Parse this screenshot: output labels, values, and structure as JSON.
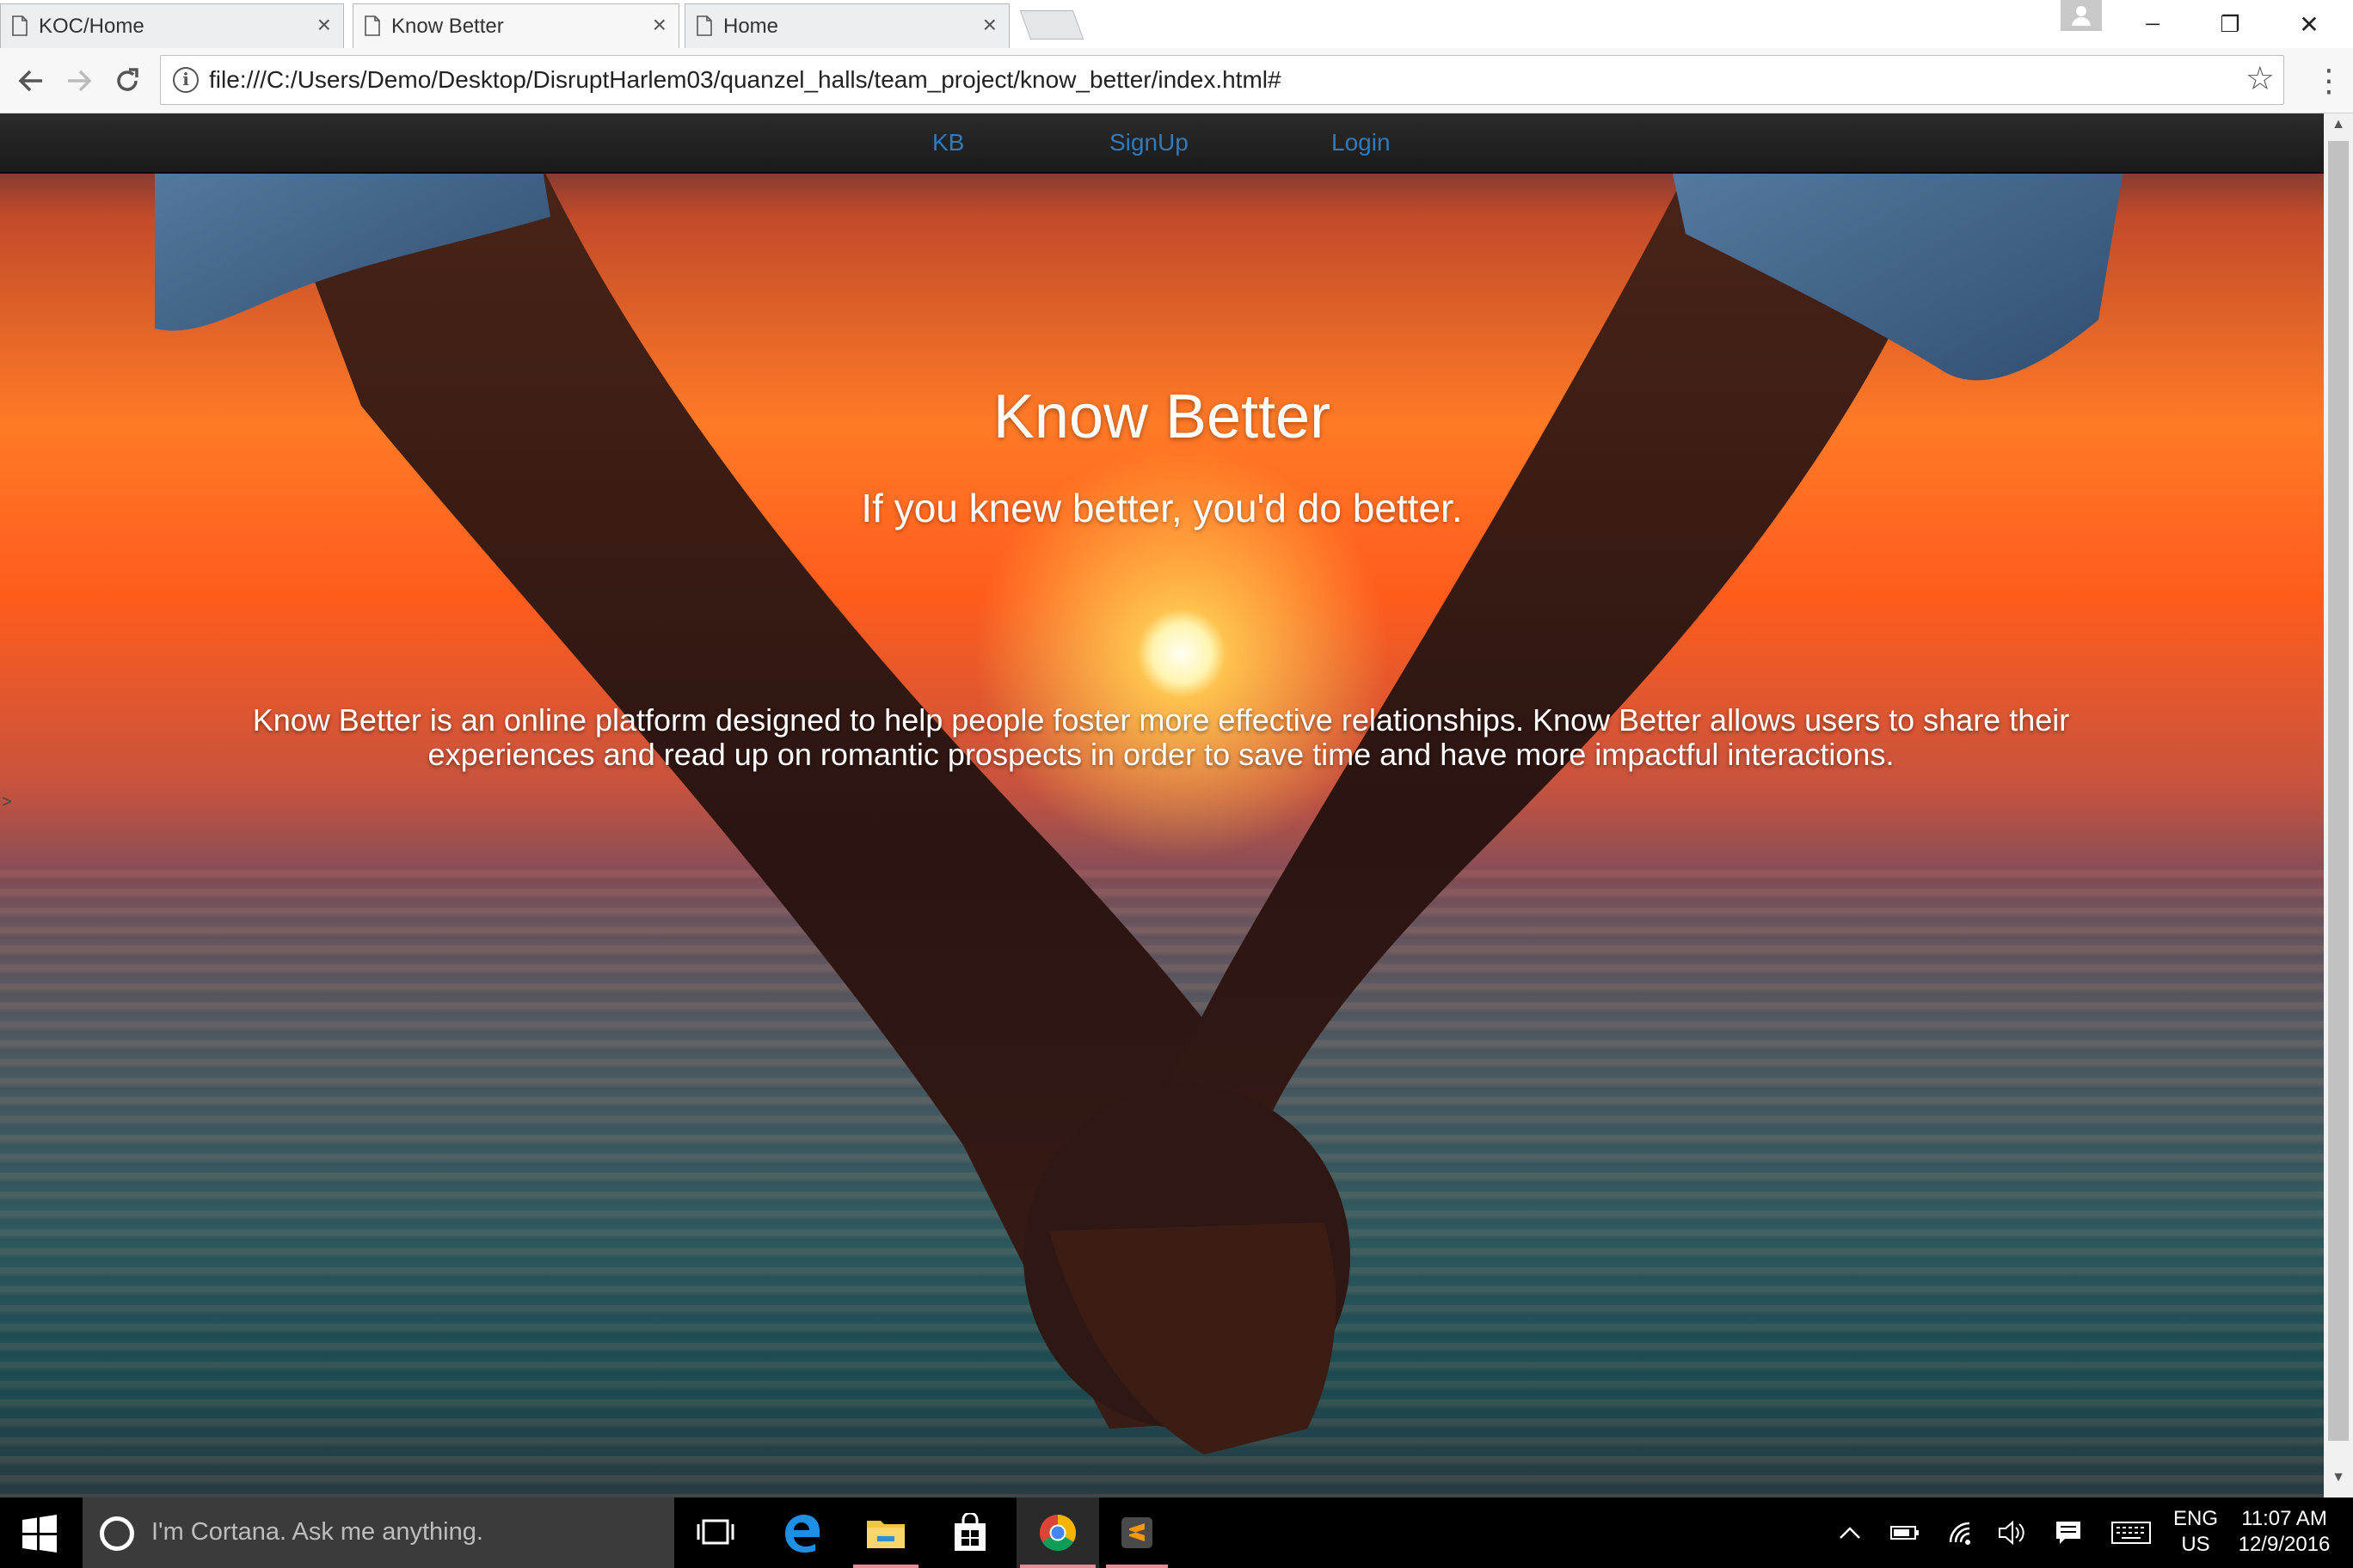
{
  "browser": {
    "tabs": [
      {
        "title": "KOC/Home",
        "active": false
      },
      {
        "title": "Know Better",
        "active": true
      },
      {
        "title": "Home",
        "active": false
      }
    ],
    "address_bar": {
      "url": "file:///C:/Users/Demo/Desktop/DisruptHarlem03/quanzel_halls/team_project/know_better/index.html#"
    },
    "window_controls": {
      "minimize": "─",
      "restore": "❐",
      "close": "✕"
    }
  },
  "site": {
    "nav": {
      "brand": "KB",
      "links": [
        "SignUp",
        "Login"
      ],
      "link_color": "#337ab7"
    },
    "hero": {
      "title": "Know Better",
      "tagline": "If you knew better, you'd do better.",
      "description": "Know Better is an online platform designed to help people foster more effective relationships. Know Better allows users to share their experiences and read up on romantic prospects in order to save time and have more impactful interactions."
    },
    "stray_text": ">"
  },
  "taskbar": {
    "search_placeholder": "I'm Cortana. Ask me anything.",
    "apps": [
      "task-view",
      "edge",
      "file-explorer",
      "store",
      "chrome",
      "sublime-text"
    ],
    "language": {
      "line1": "ENG",
      "line2": "US"
    },
    "clock": {
      "time": "11:07 AM",
      "date": "12/9/2016"
    }
  }
}
